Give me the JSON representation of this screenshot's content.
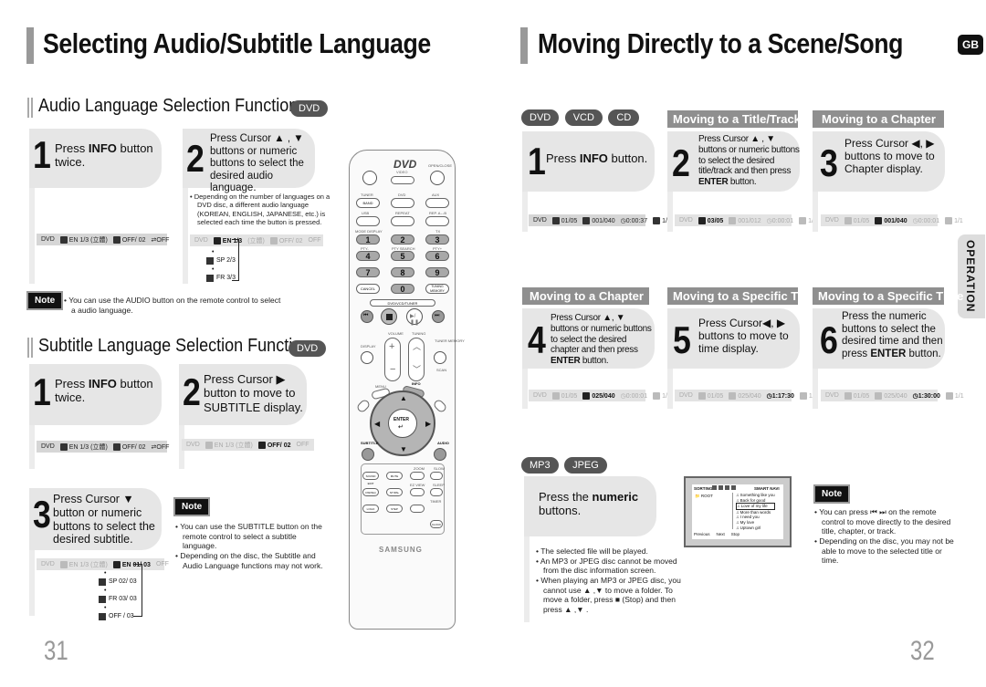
{
  "left_page": {
    "title": "Selecting Audio/Subtitle Language",
    "audio_section": {
      "title": "Audio Language Selection Function",
      "badge": "DVD",
      "step1": {
        "num": "1",
        "pre": "Press ",
        "bold": "INFO",
        "post": " button twice."
      },
      "step2": {
        "num": "2",
        "text": "Press Cursor ▲ , ▼ buttons or numeric buttons to select the desired audio language."
      },
      "step2_bullet": "Depending on the number of languages on a DVD disc, a different audio language (KOREAN, ENGLISH, JAPANESE, etc.) is selected each time the button is pressed.",
      "osd1": {
        "disc": "DVD",
        "audio": "EN 1/3",
        "audio_fmt": "(立體)",
        "subtitle": "OFF/ 02",
        "repeat": "OFF"
      },
      "osd2": {
        "disc": "DVD",
        "audio": "EN 1/3",
        "audio_fmt": "(立體)",
        "subtitle": "OFF/ 02",
        "repeat": "OFF"
      },
      "osd2_list": [
        "SP 2/3",
        "FR 3/3"
      ],
      "note_label": "Note",
      "note": "You can use the AUDIO button on the remote control to select a audio language."
    },
    "subtitle_section": {
      "title": "Subtitle Language Selection Function",
      "badge": "DVD",
      "step1": {
        "num": "1",
        "pre": "Press ",
        "bold": "INFO",
        "post": " button twice."
      },
      "step2": {
        "num": "2",
        "text": "Press Cursor ▶ button to move to SUBTITLE display."
      },
      "step3": {
        "num": "3",
        "text": "Press Cursor ▼ button or numeric buttons to select the desired subtitle."
      },
      "osd1": {
        "disc": "DVD",
        "audio": "EN 1/3",
        "audio_fmt": "(立體)",
        "subtitle": "OFF/ 02",
        "repeat": "OFF"
      },
      "osd2": {
        "disc": "DVD",
        "audio": "EN 1/3",
        "audio_fmt": "(立體)",
        "subtitle": "OFF/ 02",
        "repeat": "OFF"
      },
      "osd3": {
        "disc": "DVD",
        "audio": "EN 1/3",
        "audio_fmt": "(立體)",
        "subtitle": "EN 01/ 03",
        "repeat": "OFF"
      },
      "osd3_list": [
        "SP 02/ 03",
        "FR 03/ 03",
        "OFF / 03"
      ],
      "note_label": "Note",
      "notes": [
        "You can use the SUBTITLE button on the remote control to select a subtitle language.",
        "Depending on the disc, the Subtitle and Audio Language functions may not work."
      ]
    },
    "page_number": "31"
  },
  "remote": {
    "logo": "DVD",
    "logo_sub": "VIDEO",
    "brand": "SAMSUNG",
    "labels": {
      "open_close": "OPEN/CLOSE",
      "tuner": "TUNER",
      "dvd": "DVD",
      "aux": "AUX",
      "band": "BAND",
      "usb": "USB",
      "repeat": "REPEAT",
      "rep_ab": "REP. A↔B",
      "mode_display": "MODE DISPLAY",
      "tx": "TX",
      "pty_minus": "PTY-",
      "pty_search": "PTY SEARCH",
      "pty_plus": "PTY+",
      "cancel": "CANCEL",
      "tuning_memory": "TUNING MEMORY",
      "dvd_vcd_tuner": "DVD/VCD/TUNER",
      "volume": "VOLUME",
      "tuning": "TUNING",
      "display": "DISPLAY",
      "tuner_memory": "TUNER MEMORY",
      "scan": "SCAN",
      "menu": "MENU",
      "info": "INFO",
      "return": "RETURN",
      "cancel2": "CANCEL",
      "enter": "ENTER",
      "subtitle": "SUBTITLE",
      "audio": "AUDIO",
      "zoom": "ZOOM",
      "slow": "SLOW",
      "ez_view": "EZ VIEW",
      "sleep": "SLEEP",
      "sound_edit": "SOUND EDIT",
      "mute": "MUTE",
      "timer": "TIMER",
      "clock": "CLOCK",
      "logo_btn": "LOGO",
      "step": "STEP",
      "dsp": "DSP/EQ",
      "ntsc": "NT/PAL",
      "demo": "DEMO/DIMMER"
    },
    "number_keys": [
      "1",
      "2",
      "3",
      "4",
      "5",
      "6",
      "7",
      "8",
      "9",
      "0"
    ]
  },
  "right_page": {
    "title": "Moving Directly to a Scene/Song",
    "lang_badge": "GB",
    "side_tab": "OPERATION",
    "disc_badges": [
      "DVD",
      "VCD",
      "CD"
    ],
    "step1": {
      "num": "1",
      "pre": "Press ",
      "bold": "INFO",
      "post": " button."
    },
    "osd1": {
      "disc": "DVD",
      "title": "01/05",
      "chapter": "001/040",
      "time": "0:00:37",
      "angle": "1/1"
    },
    "title_track": {
      "heading": "Moving to a Title/Track",
      "step": {
        "num": "2",
        "pre": "Press Cursor ▲ , ▼ buttons or numeric buttons to select the desired title/track and then press ",
        "bold": "ENTER",
        "post": " button."
      },
      "osd": {
        "disc": "DVD",
        "title": "03/05",
        "chapter": "001/012",
        "time": "0:00:01",
        "angle": "1/1"
      }
    },
    "chapter3": {
      "heading": "Moving to a Chapter",
      "step": {
        "num": "3",
        "text": "Press Cursor ◀, ▶ buttons to move to Chapter display."
      },
      "osd": {
        "disc": "DVD",
        "title": "01/05",
        "chapter": "001/040",
        "time": "0:00:01",
        "angle": "1/1"
      }
    },
    "chapter4": {
      "heading": "Moving to a Chapter",
      "step": {
        "num": "4",
        "pre": "Press Cursor ▲, ▼ buttons or numeric buttons to select the desired chapter and then press ",
        "bold": "ENTER",
        "post": " button."
      },
      "osd": {
        "disc": "DVD",
        "title": "01/05",
        "chapter": "025/040",
        "time": "0:00:01",
        "angle": "1/1"
      }
    },
    "time5": {
      "heading": "Moving to a Specific Time",
      "step": {
        "num": "5",
        "text": "Press Cursor◀, ▶ buttons to move to time display."
      },
      "osd": {
        "disc": "DVD",
        "title": "01/05",
        "chapter": "025/040",
        "time": "1:17:30",
        "angle": "1/1"
      }
    },
    "time6": {
      "heading": "Moving to a Specific Time",
      "step": {
        "num": "6",
        "pre": "Press the numeric buttons to select the desired time and then press ",
        "bold": "ENTER",
        "post": " button."
      },
      "osd": {
        "disc": "DVD",
        "title": "01/05",
        "chapter": "025/040",
        "time": "1:30:00",
        "angle": "1/1"
      }
    },
    "mp3": {
      "badges": [
        "MP3",
        "JPEG"
      ],
      "pre": "Press the ",
      "bold": "numeric",
      "post": " buttons.",
      "bullets": [
        "The selected file will be played.",
        "An MP3 or JPEG disc cannot be moved from the disc information screen.",
        "When playing an MP3 or JPEG disc, you cannot use ▲ ,▼  to move a folder. To move a folder, press ■ (Stop) and then press ▲ ,▼ ."
      ],
      "screen": {
        "sorting_label": "SORTING",
        "smart_navi": "SMART NAVI",
        "folder": "ROOT",
        "tracks": [
          "Something like you",
          "Back for good",
          "Love of my life",
          "More than words",
          "I need you",
          "My love",
          "Uptown girl"
        ],
        "selected_track": "Love of my life",
        "footer": [
          "Previous",
          "Next",
          "Stop"
        ]
      }
    },
    "note_label": "Note",
    "notes": [
      "You can press ⏮ ⏭ on the remote control to move directly to the desired title, chapter, or track.",
      "Depending on the disc, you may not be able to move to the selected title or time."
    ],
    "page_number": "32"
  }
}
